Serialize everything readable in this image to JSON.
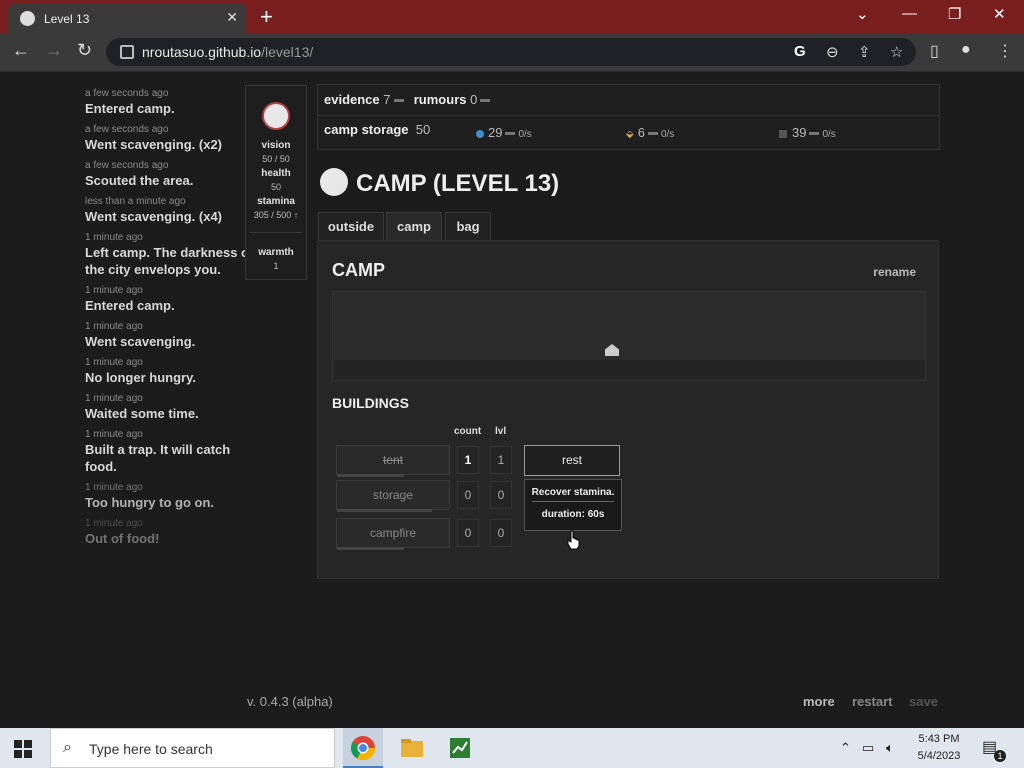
{
  "browser": {
    "tab_title": "Level 13",
    "url_host": "nroutasuo.github.io",
    "url_path": "/level13/"
  },
  "log": [
    {
      "time": "a few seconds ago",
      "msg": "Entered camp."
    },
    {
      "time": "a few seconds ago",
      "msg": "Went scavenging. (x2)"
    },
    {
      "time": "a few seconds ago",
      "msg": "Scouted the area."
    },
    {
      "time": "less than a minute ago",
      "msg": "Went scavenging. (x4)"
    },
    {
      "time": "1 minute ago",
      "msg": "Left camp. The darkness of the city envelops you."
    },
    {
      "time": "1 minute ago",
      "msg": "Entered camp."
    },
    {
      "time": "1 minute ago",
      "msg": "Went scavenging."
    },
    {
      "time": "1 minute ago",
      "msg": "No longer hungry."
    },
    {
      "time": "1 minute ago",
      "msg": "Waited some time."
    },
    {
      "time": "1 minute ago",
      "msg": "Built a trap. It will catch food."
    },
    {
      "time": "1 minute ago",
      "msg": "Too hungry to go on."
    },
    {
      "time": "1 minute ago",
      "msg": "Out of food!"
    }
  ],
  "stats": {
    "vision_label": "vision",
    "vision_value": "50 / 50",
    "health_label": "health",
    "health_value": "50",
    "stamina_label": "stamina",
    "stamina_value": "305 / 500 ↑",
    "warmth_label": "warmth",
    "warmth_value": "1"
  },
  "resources": {
    "evidence_label": "evidence",
    "evidence_value": "7",
    "rumours_label": "rumours",
    "rumours_value": "0",
    "storage_label": "camp storage",
    "storage_value": "50",
    "water_value": "29",
    "water_rate": "0/s",
    "food_value": "6",
    "food_rate": "0/s",
    "metal_value": "39",
    "metal_rate": "0/s"
  },
  "page_title": "CAMP (LEVEL 13)",
  "tabs": [
    "outside",
    "camp",
    "bag"
  ],
  "camp": {
    "heading": "CAMP",
    "rename_label": "rename",
    "buildings_heading": "BUILDINGS",
    "col_count": "count",
    "col_lvl": "lvl",
    "buildings": [
      {
        "name": "tent",
        "count": "1",
        "lvl": "1",
        "progress": 0.6
      },
      {
        "name": "storage",
        "count": "0",
        "lvl": "0",
        "progress": 0.85
      },
      {
        "name": "campfire",
        "count": "0",
        "lvl": "0",
        "progress": 0.6
      }
    ],
    "rest_label": "rest",
    "tooltip_line1": "Recover stamina.",
    "tooltip_line2": "duration: 60s"
  },
  "footer": {
    "version": "v. 0.4.3 (alpha)",
    "more": "more",
    "restart": "restart",
    "save": "save"
  },
  "taskbar": {
    "search_placeholder": "Type here to search",
    "time": "5:43 PM",
    "date": "5/4/2023",
    "notification_count": "1"
  }
}
